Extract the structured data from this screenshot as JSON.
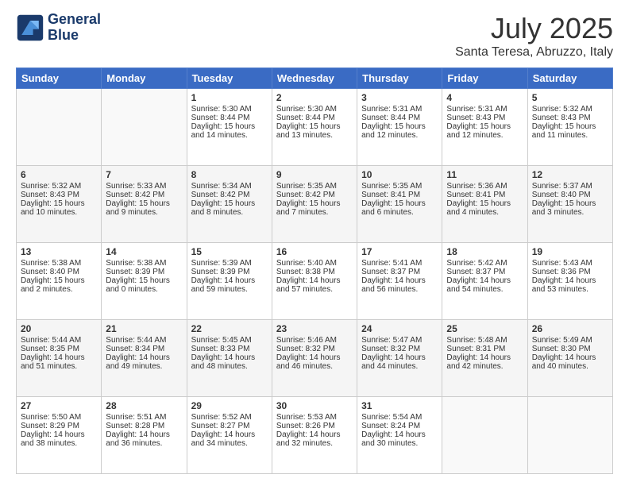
{
  "header": {
    "logo_line1": "General",
    "logo_line2": "Blue",
    "month": "July 2025",
    "location": "Santa Teresa, Abruzzo, Italy"
  },
  "days_of_week": [
    "Sunday",
    "Monday",
    "Tuesday",
    "Wednesday",
    "Thursday",
    "Friday",
    "Saturday"
  ],
  "weeks": [
    [
      {
        "day": "",
        "info": ""
      },
      {
        "day": "",
        "info": ""
      },
      {
        "day": "1",
        "info": "Sunrise: 5:30 AM\nSunset: 8:44 PM\nDaylight: 15 hours\nand 14 minutes."
      },
      {
        "day": "2",
        "info": "Sunrise: 5:30 AM\nSunset: 8:44 PM\nDaylight: 15 hours\nand 13 minutes."
      },
      {
        "day": "3",
        "info": "Sunrise: 5:31 AM\nSunset: 8:44 PM\nDaylight: 15 hours\nand 12 minutes."
      },
      {
        "day": "4",
        "info": "Sunrise: 5:31 AM\nSunset: 8:43 PM\nDaylight: 15 hours\nand 12 minutes."
      },
      {
        "day": "5",
        "info": "Sunrise: 5:32 AM\nSunset: 8:43 PM\nDaylight: 15 hours\nand 11 minutes."
      }
    ],
    [
      {
        "day": "6",
        "info": "Sunrise: 5:32 AM\nSunset: 8:43 PM\nDaylight: 15 hours\nand 10 minutes."
      },
      {
        "day": "7",
        "info": "Sunrise: 5:33 AM\nSunset: 8:42 PM\nDaylight: 15 hours\nand 9 minutes."
      },
      {
        "day": "8",
        "info": "Sunrise: 5:34 AM\nSunset: 8:42 PM\nDaylight: 15 hours\nand 8 minutes."
      },
      {
        "day": "9",
        "info": "Sunrise: 5:35 AM\nSunset: 8:42 PM\nDaylight: 15 hours\nand 7 minutes."
      },
      {
        "day": "10",
        "info": "Sunrise: 5:35 AM\nSunset: 8:41 PM\nDaylight: 15 hours\nand 6 minutes."
      },
      {
        "day": "11",
        "info": "Sunrise: 5:36 AM\nSunset: 8:41 PM\nDaylight: 15 hours\nand 4 minutes."
      },
      {
        "day": "12",
        "info": "Sunrise: 5:37 AM\nSunset: 8:40 PM\nDaylight: 15 hours\nand 3 minutes."
      }
    ],
    [
      {
        "day": "13",
        "info": "Sunrise: 5:38 AM\nSunset: 8:40 PM\nDaylight: 15 hours\nand 2 minutes."
      },
      {
        "day": "14",
        "info": "Sunrise: 5:38 AM\nSunset: 8:39 PM\nDaylight: 15 hours\nand 0 minutes."
      },
      {
        "day": "15",
        "info": "Sunrise: 5:39 AM\nSunset: 8:39 PM\nDaylight: 14 hours\nand 59 minutes."
      },
      {
        "day": "16",
        "info": "Sunrise: 5:40 AM\nSunset: 8:38 PM\nDaylight: 14 hours\nand 57 minutes."
      },
      {
        "day": "17",
        "info": "Sunrise: 5:41 AM\nSunset: 8:37 PM\nDaylight: 14 hours\nand 56 minutes."
      },
      {
        "day": "18",
        "info": "Sunrise: 5:42 AM\nSunset: 8:37 PM\nDaylight: 14 hours\nand 54 minutes."
      },
      {
        "day": "19",
        "info": "Sunrise: 5:43 AM\nSunset: 8:36 PM\nDaylight: 14 hours\nand 53 minutes."
      }
    ],
    [
      {
        "day": "20",
        "info": "Sunrise: 5:44 AM\nSunset: 8:35 PM\nDaylight: 14 hours\nand 51 minutes."
      },
      {
        "day": "21",
        "info": "Sunrise: 5:44 AM\nSunset: 8:34 PM\nDaylight: 14 hours\nand 49 minutes."
      },
      {
        "day": "22",
        "info": "Sunrise: 5:45 AM\nSunset: 8:33 PM\nDaylight: 14 hours\nand 48 minutes."
      },
      {
        "day": "23",
        "info": "Sunrise: 5:46 AM\nSunset: 8:32 PM\nDaylight: 14 hours\nand 46 minutes."
      },
      {
        "day": "24",
        "info": "Sunrise: 5:47 AM\nSunset: 8:32 PM\nDaylight: 14 hours\nand 44 minutes."
      },
      {
        "day": "25",
        "info": "Sunrise: 5:48 AM\nSunset: 8:31 PM\nDaylight: 14 hours\nand 42 minutes."
      },
      {
        "day": "26",
        "info": "Sunrise: 5:49 AM\nSunset: 8:30 PM\nDaylight: 14 hours\nand 40 minutes."
      }
    ],
    [
      {
        "day": "27",
        "info": "Sunrise: 5:50 AM\nSunset: 8:29 PM\nDaylight: 14 hours\nand 38 minutes."
      },
      {
        "day": "28",
        "info": "Sunrise: 5:51 AM\nSunset: 8:28 PM\nDaylight: 14 hours\nand 36 minutes."
      },
      {
        "day": "29",
        "info": "Sunrise: 5:52 AM\nSunset: 8:27 PM\nDaylight: 14 hours\nand 34 minutes."
      },
      {
        "day": "30",
        "info": "Sunrise: 5:53 AM\nSunset: 8:26 PM\nDaylight: 14 hours\nand 32 minutes."
      },
      {
        "day": "31",
        "info": "Sunrise: 5:54 AM\nSunset: 8:24 PM\nDaylight: 14 hours\nand 30 minutes."
      },
      {
        "day": "",
        "info": ""
      },
      {
        "day": "",
        "info": ""
      }
    ]
  ]
}
